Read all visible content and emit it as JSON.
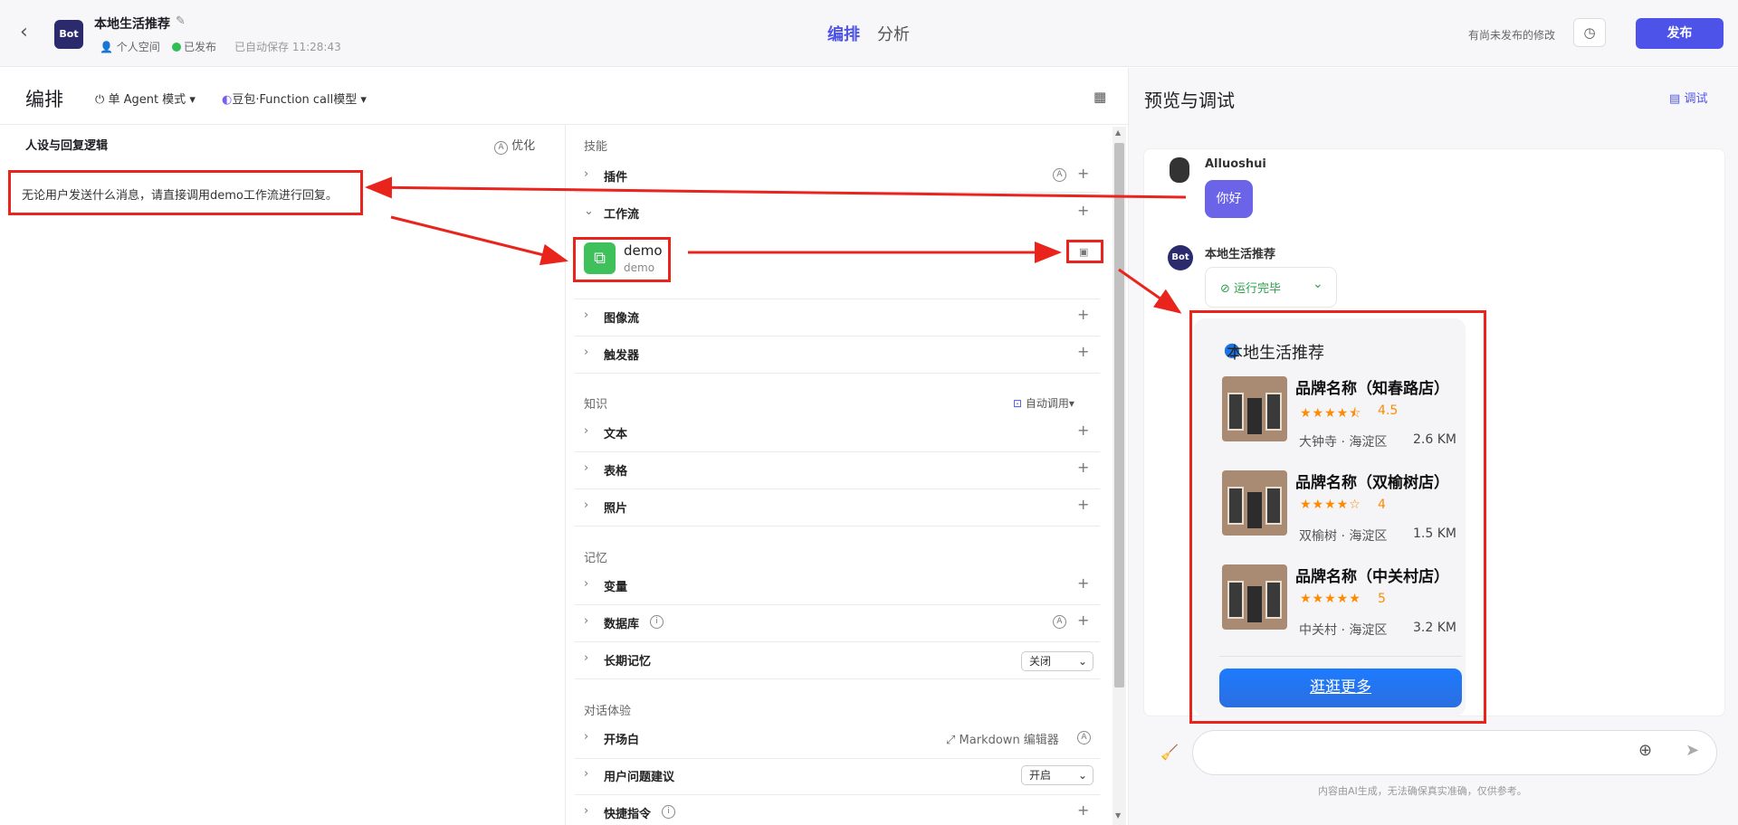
{
  "header": {
    "bot_badge": "Bot",
    "bot_name": "本地生活推荐",
    "space": "个人空间",
    "publish_status": "已发布",
    "autosave": "已自动保存 11:28:43",
    "tabs": [
      "编排",
      "分析"
    ],
    "unpublished_note": "有尚未发布的修改",
    "publish_label": "发布"
  },
  "editor": {
    "title": "编排",
    "agent_mode": "单 Agent 模式",
    "model": "豆包·Function call模型",
    "persona_title": "人设与回复逻辑",
    "optimize_label": "优化",
    "prompt": "无论用户发送什么消息，请直接调用demo工作流进行回复。"
  },
  "skills": {
    "group_skill": "技能",
    "plugin": "插件",
    "workflow": "工作流",
    "workflow_item": {
      "name": "demo",
      "desc": "demo"
    },
    "imageflow": "图像流",
    "trigger": "触发器",
    "group_knowledge": "知识",
    "auto_call": "自动调用",
    "text": "文本",
    "table": "表格",
    "photo": "照片",
    "group_memory": "记忆",
    "variable": "变量",
    "database": "数据库",
    "long_memory": "长期记忆",
    "long_memory_value": "关闭",
    "group_dialog": "对话体验",
    "opening": "开场白",
    "markdown_editor": "Markdown 编辑器",
    "suggestions": "用户问题建议",
    "suggestions_value": "开启",
    "shortcut": "快捷指令"
  },
  "preview": {
    "title": "预览与调试",
    "debug_label": "调试",
    "user_name": "Alluoshui",
    "user_msg": "你好",
    "bot_name": "本地生活推荐",
    "bot_badge": "Bot",
    "run_status": "运行完毕",
    "card_title": "本地生活推荐",
    "shops": [
      {
        "name": "品牌名称（知春路店）",
        "stars": "★★★★⯪",
        "rating": "4.5",
        "addr": "大钟寺 · 海淀区",
        "dist": "2.6 KM"
      },
      {
        "name": "品牌名称（双榆树店）",
        "stars": "★★★★☆",
        "rating": "4",
        "addr": "双榆树 · 海淀区",
        "dist": "1.5 KM"
      },
      {
        "name": "品牌名称（中关村店）",
        "stars": "★★★★★",
        "rating": "5",
        "addr": "中关村 · 海淀区",
        "dist": "3.2 KM"
      }
    ],
    "more_label": "逛逛更多",
    "disclaimer": "内容由AI生成，无法确保真实准确，仅供参考。"
  },
  "colors": {
    "accent": "#4d53e8",
    "annotation": "#e8241c",
    "star": "#ff8a00"
  }
}
